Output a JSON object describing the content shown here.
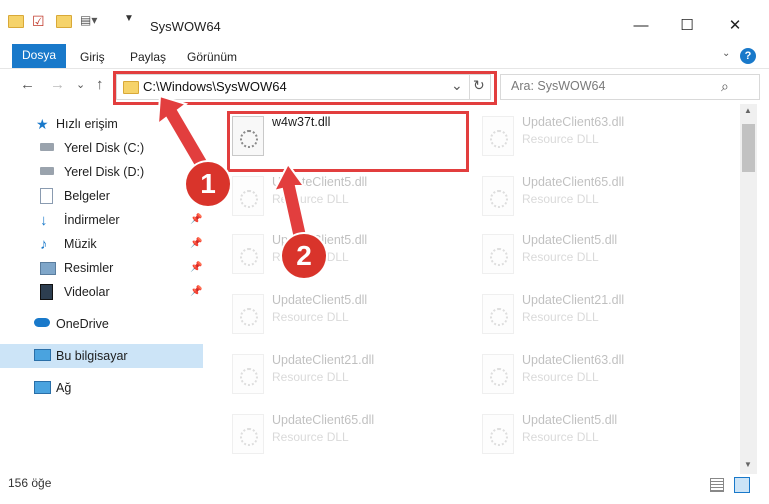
{
  "window": {
    "title": "SysWOW64",
    "minimize": "—",
    "maximize": "☐",
    "close": "✕",
    "help": "?"
  },
  "ribbon": {
    "tabs": [
      "Dosya",
      "Giriş",
      "Paylaş",
      "Görünüm"
    ]
  },
  "address": {
    "path": "C:\\Windows\\SysWOW64",
    "chevron": "⌄",
    "refresh": "↻"
  },
  "search": {
    "placeholder": "Ara: SysWOW64"
  },
  "nav": {
    "back": "←",
    "forward": "→",
    "recent": "⌄",
    "up": "↑"
  },
  "sidebar": {
    "items": [
      {
        "label": "Hızlı erişim",
        "icon": "star-icon"
      },
      {
        "label": "Yerel Disk (C:)",
        "icon": "drive-icon"
      },
      {
        "label": "Yerel Disk (D:)",
        "icon": "drive-icon"
      },
      {
        "label": "Belgeler",
        "icon": "documents-icon"
      },
      {
        "label": "İndirmeler",
        "icon": "download-icon"
      },
      {
        "label": "Müzik",
        "icon": "music-icon"
      },
      {
        "label": "Resimler",
        "icon": "pictures-icon"
      },
      {
        "label": "Videolar",
        "icon": "video-icon"
      },
      {
        "label": "OneDrive",
        "icon": "cloud-icon"
      },
      {
        "label": "Bu bilgisayar",
        "icon": "computer-icon"
      },
      {
        "label": "Ağ",
        "icon": "network-icon"
      }
    ]
  },
  "files": {
    "col1": [
      {
        "name": "w4w37t.dll",
        "type": ""
      },
      {
        "name": "UpdateClient5.dll",
        "type": "Resource DLL"
      },
      {
        "name": "UpdateClient5.dll",
        "type": "Resource DLL"
      },
      {
        "name": "UpdateClient5.dll",
        "type": "Resource DLL"
      },
      {
        "name": "UpdateClient21.dll",
        "type": "Resource DLL"
      },
      {
        "name": "UpdateClient65.dll",
        "type": "Resource DLL"
      }
    ],
    "col2": [
      {
        "name": "UpdateClient63.dll",
        "type": "Resource DLL"
      },
      {
        "name": "UpdateClient65.dll",
        "type": "Resource DLL"
      },
      {
        "name": "UpdateClient5.dll",
        "type": "Resource DLL"
      },
      {
        "name": "UpdateClient21.dll",
        "type": "Resource DLL"
      },
      {
        "name": "UpdateClient63.dll",
        "type": "Resource DLL"
      },
      {
        "name": "UpdateClient5.dll",
        "type": "Resource DLL"
      }
    ]
  },
  "status": {
    "count": "156 öğe"
  },
  "annotations": {
    "step1": "1",
    "step2": "2"
  },
  "colors": {
    "accent": "#1979ca",
    "annotation": "#e23e3e"
  }
}
